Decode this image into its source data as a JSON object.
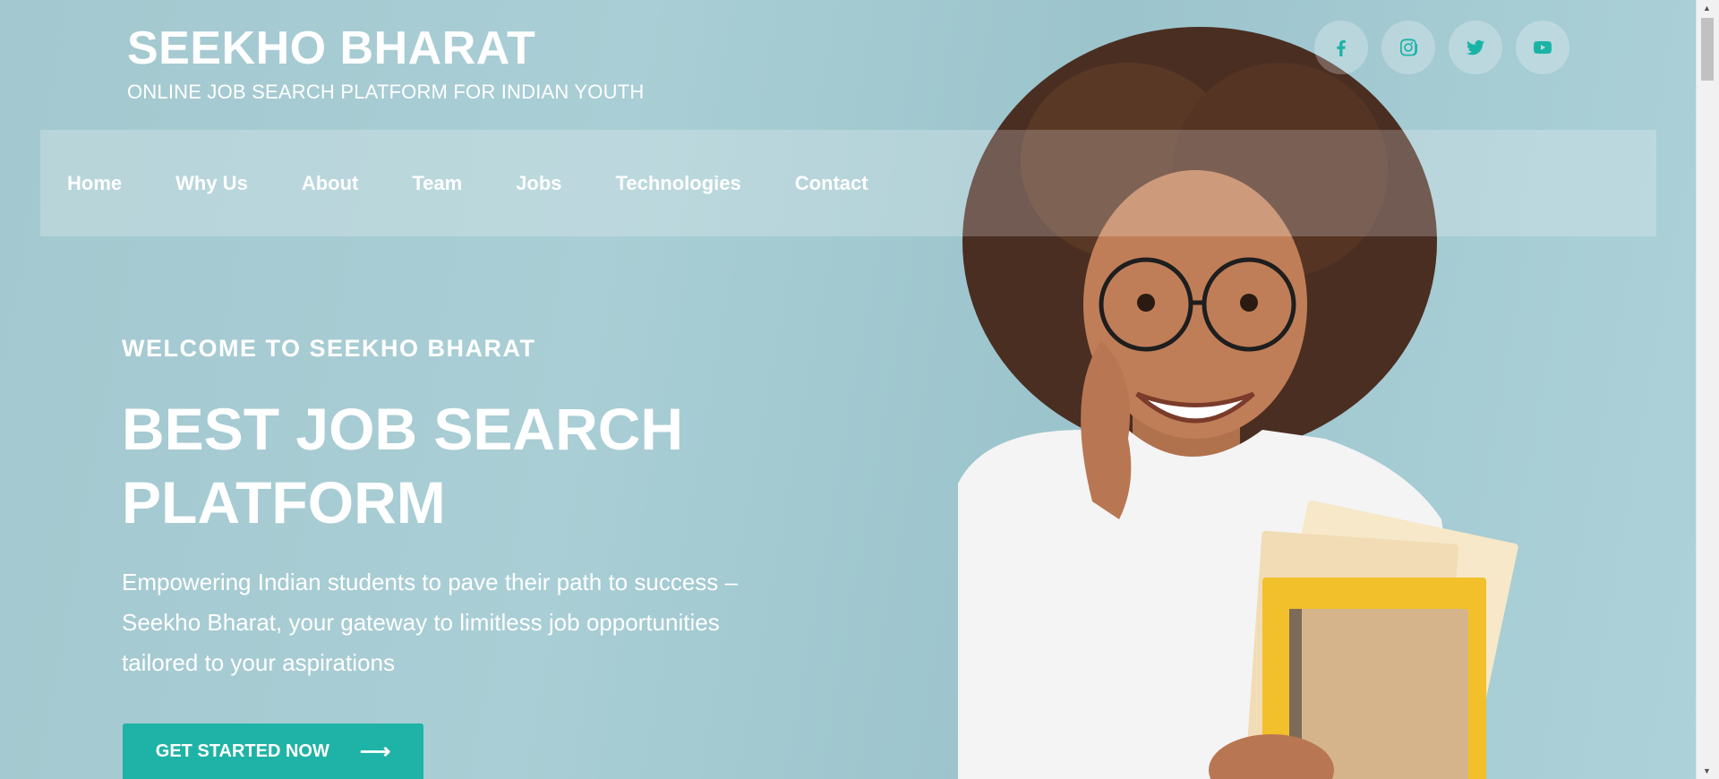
{
  "brand": {
    "title": "SEEKHO BHARAT",
    "subtitle": "ONLINE JOB SEARCH PLATFORM FOR INDIAN YOUTH"
  },
  "socials": [
    {
      "icon": "facebook-icon"
    },
    {
      "icon": "instagram-icon"
    },
    {
      "icon": "twitter-icon"
    },
    {
      "icon": "youtube-icon"
    }
  ],
  "nav": {
    "items": [
      {
        "label": "Home"
      },
      {
        "label": "Why Us"
      },
      {
        "label": "About"
      },
      {
        "label": "Team"
      },
      {
        "label": "Jobs"
      },
      {
        "label": "Technologies"
      },
      {
        "label": "Contact"
      }
    ]
  },
  "hero": {
    "kicker": "WELCOME TO SEEKHO BHARAT",
    "headline": "BEST JOB SEARCH PLATFORM",
    "lead": "Empowering Indian students to pave their path to success – Seekho Bharat, your gateway to limitless job opportunities tailored to your aspirations",
    "cta_label": "GET STARTED NOW",
    "cta_icon": "arrow-right-icon"
  },
  "colors": {
    "accent": "#1eb3a6",
    "background": "#a6cbd2",
    "text": "#ffffff"
  }
}
